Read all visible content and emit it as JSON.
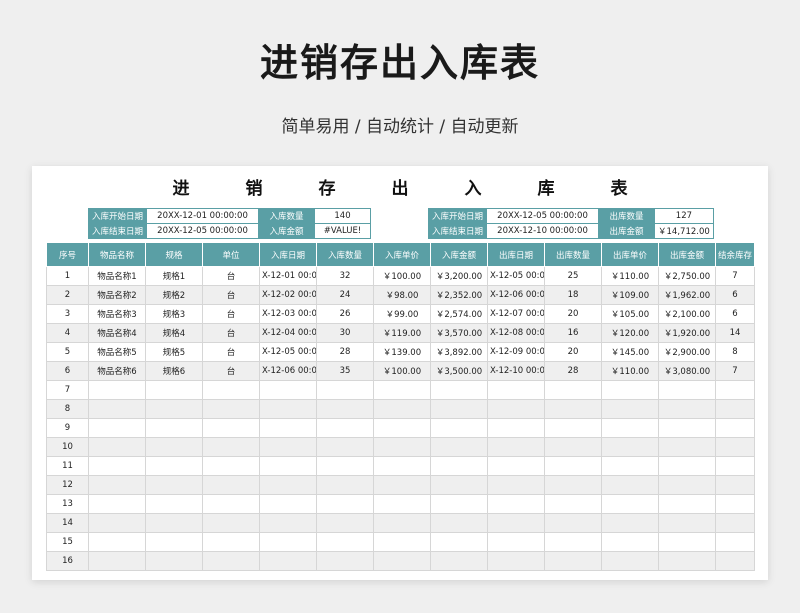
{
  "poster": {
    "title": "进销存出入库表",
    "subtitle": "简单易用 / 自动统计 / 自动更新"
  },
  "sheet": {
    "title_chars": [
      "进",
      "销",
      "存",
      "出",
      "入",
      "库",
      "表"
    ],
    "info_left": {
      "start_label": "入库开始日期",
      "start_value": "20XX-12-01 00:00:00",
      "qty_label": "入库数量",
      "qty_value": "140",
      "end_label": "入库结束日期",
      "end_value": "20XX-12-05 00:00:00",
      "amount_label": "入库金额",
      "amount_value": "#VALUE!"
    },
    "info_right": {
      "start_label": "入库开始日期",
      "start_value": "20XX-12-05 00:00:00",
      "qty_label": "出库数量",
      "qty_value": "127",
      "end_label": "入库结束日期",
      "end_value": "20XX-12-10 00:00:00",
      "amount_label": "出库金额",
      "amount_value": "￥14,712.00"
    },
    "columns": [
      "序号",
      "物品名称",
      "规格",
      "单位",
      "入库日期",
      "入库数量",
      "入库单价",
      "入库金额",
      "出库日期",
      "出库数量",
      "出库单价",
      "出库金额",
      "结余库存"
    ],
    "rows": [
      [
        "1",
        "物品名称1",
        "规格1",
        "台",
        "X-12-01 00:00",
        "32",
        "￥100.00",
        "￥3,200.00",
        "X-12-05 00:00",
        "25",
        "￥110.00",
        "￥2,750.00",
        "7"
      ],
      [
        "2",
        "物品名称2",
        "规格2",
        "台",
        "X-12-02 00:00",
        "24",
        "￥98.00",
        "￥2,352.00",
        "X-12-06 00:00",
        "18",
        "￥109.00",
        "￥1,962.00",
        "6"
      ],
      [
        "3",
        "物品名称3",
        "规格3",
        "台",
        "X-12-03 00:00",
        "26",
        "￥99.00",
        "￥2,574.00",
        "X-12-07 00:00",
        "20",
        "￥105.00",
        "￥2,100.00",
        "6"
      ],
      [
        "4",
        "物品名称4",
        "规格4",
        "台",
        "X-12-04 00:00",
        "30",
        "￥119.00",
        "￥3,570.00",
        "X-12-08 00:00",
        "16",
        "￥120.00",
        "￥1,920.00",
        "14"
      ],
      [
        "5",
        "物品名称5",
        "规格5",
        "台",
        "X-12-05 00:00",
        "28",
        "￥139.00",
        "￥3,892.00",
        "X-12-09 00:00",
        "20",
        "￥145.00",
        "￥2,900.00",
        "8"
      ],
      [
        "6",
        "物品名称6",
        "规格6",
        "台",
        "X-12-06 00:00",
        "35",
        "￥100.00",
        "￥3,500.00",
        "X-12-10 00:00",
        "28",
        "￥110.00",
        "￥3,080.00",
        "7"
      ],
      [
        "7",
        "",
        "",
        "",
        "",
        "",
        "",
        "",
        "",
        "",
        "",
        "",
        ""
      ],
      [
        "8",
        "",
        "",
        "",
        "",
        "",
        "",
        "",
        "",
        "",
        "",
        "",
        ""
      ],
      [
        "9",
        "",
        "",
        "",
        "",
        "",
        "",
        "",
        "",
        "",
        "",
        "",
        ""
      ],
      [
        "10",
        "",
        "",
        "",
        "",
        "",
        "",
        "",
        "",
        "",
        "",
        "",
        ""
      ],
      [
        "11",
        "",
        "",
        "",
        "",
        "",
        "",
        "",
        "",
        "",
        "",
        "",
        ""
      ],
      [
        "12",
        "",
        "",
        "",
        "",
        "",
        "",
        "",
        "",
        "",
        "",
        "",
        ""
      ],
      [
        "13",
        "",
        "",
        "",
        "",
        "",
        "",
        "",
        "",
        "",
        "",
        "",
        ""
      ],
      [
        "14",
        "",
        "",
        "",
        "",
        "",
        "",
        "",
        "",
        "",
        "",
        "",
        ""
      ],
      [
        "15",
        "",
        "",
        "",
        "",
        "",
        "",
        "",
        "",
        "",
        "",
        "",
        ""
      ],
      [
        "16",
        "",
        "",
        "",
        "",
        "",
        "",
        "",
        "",
        "",
        "",
        "",
        ""
      ]
    ]
  },
  "colors": {
    "header": "#5a9fa5",
    "alt_row": "#efefef"
  }
}
